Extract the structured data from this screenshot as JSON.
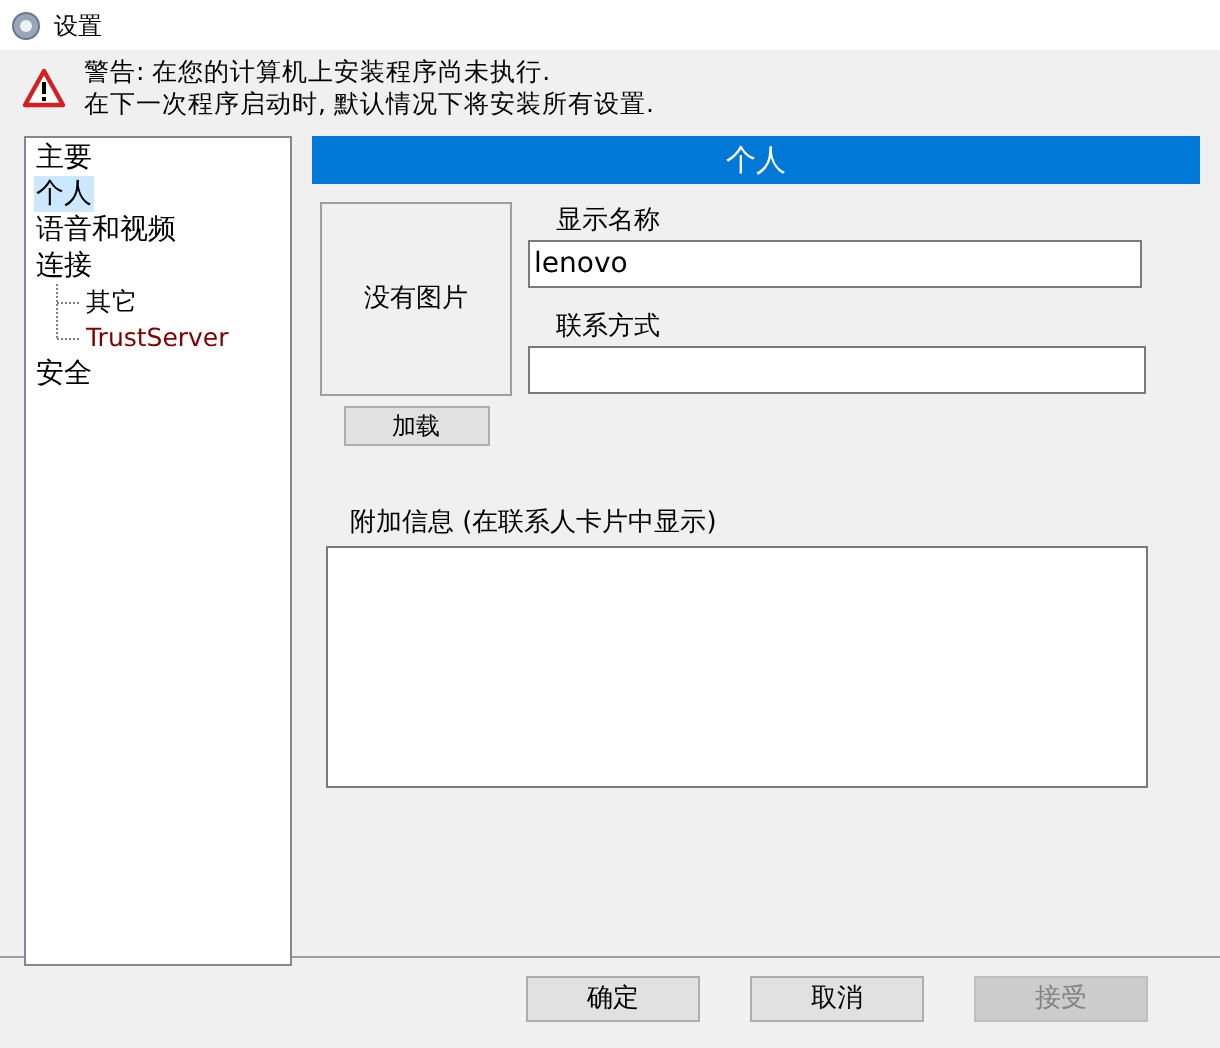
{
  "window": {
    "title": "设置"
  },
  "warning": {
    "lines": [
      "警告: 在您的计算机上安装程序尚未执行.",
      "在下一次程序启动时, 默认情况下将安装所有设置."
    ]
  },
  "tree": [
    {
      "label": "主要",
      "selected": false
    },
    {
      "label": "个人",
      "selected": true
    },
    {
      "label": "语音和视频",
      "selected": false
    },
    {
      "label": "连接",
      "selected": false,
      "children": [
        {
          "label": "其它",
          "selected": false,
          "color": "#000000"
        },
        {
          "label": "TrustServer",
          "selected": false,
          "color": "#800000"
        }
      ]
    },
    {
      "label": "安全",
      "selected": false
    }
  ],
  "panel": {
    "title": "个人",
    "picture_placeholder": "没有图片",
    "load_button": "加载",
    "display_name": {
      "label": "显示名称",
      "value": "lenovo"
    },
    "contact": {
      "label": "联系方式"
    },
    "extra_info": {
      "label": "附加信息 (在联系人卡片中显示)"
    }
  },
  "buttons": [
    {
      "label": "确定",
      "disabled": false
    },
    {
      "label": "取消",
      "disabled": false
    },
    {
      "label": "接受",
      "disabled": true
    }
  ]
}
